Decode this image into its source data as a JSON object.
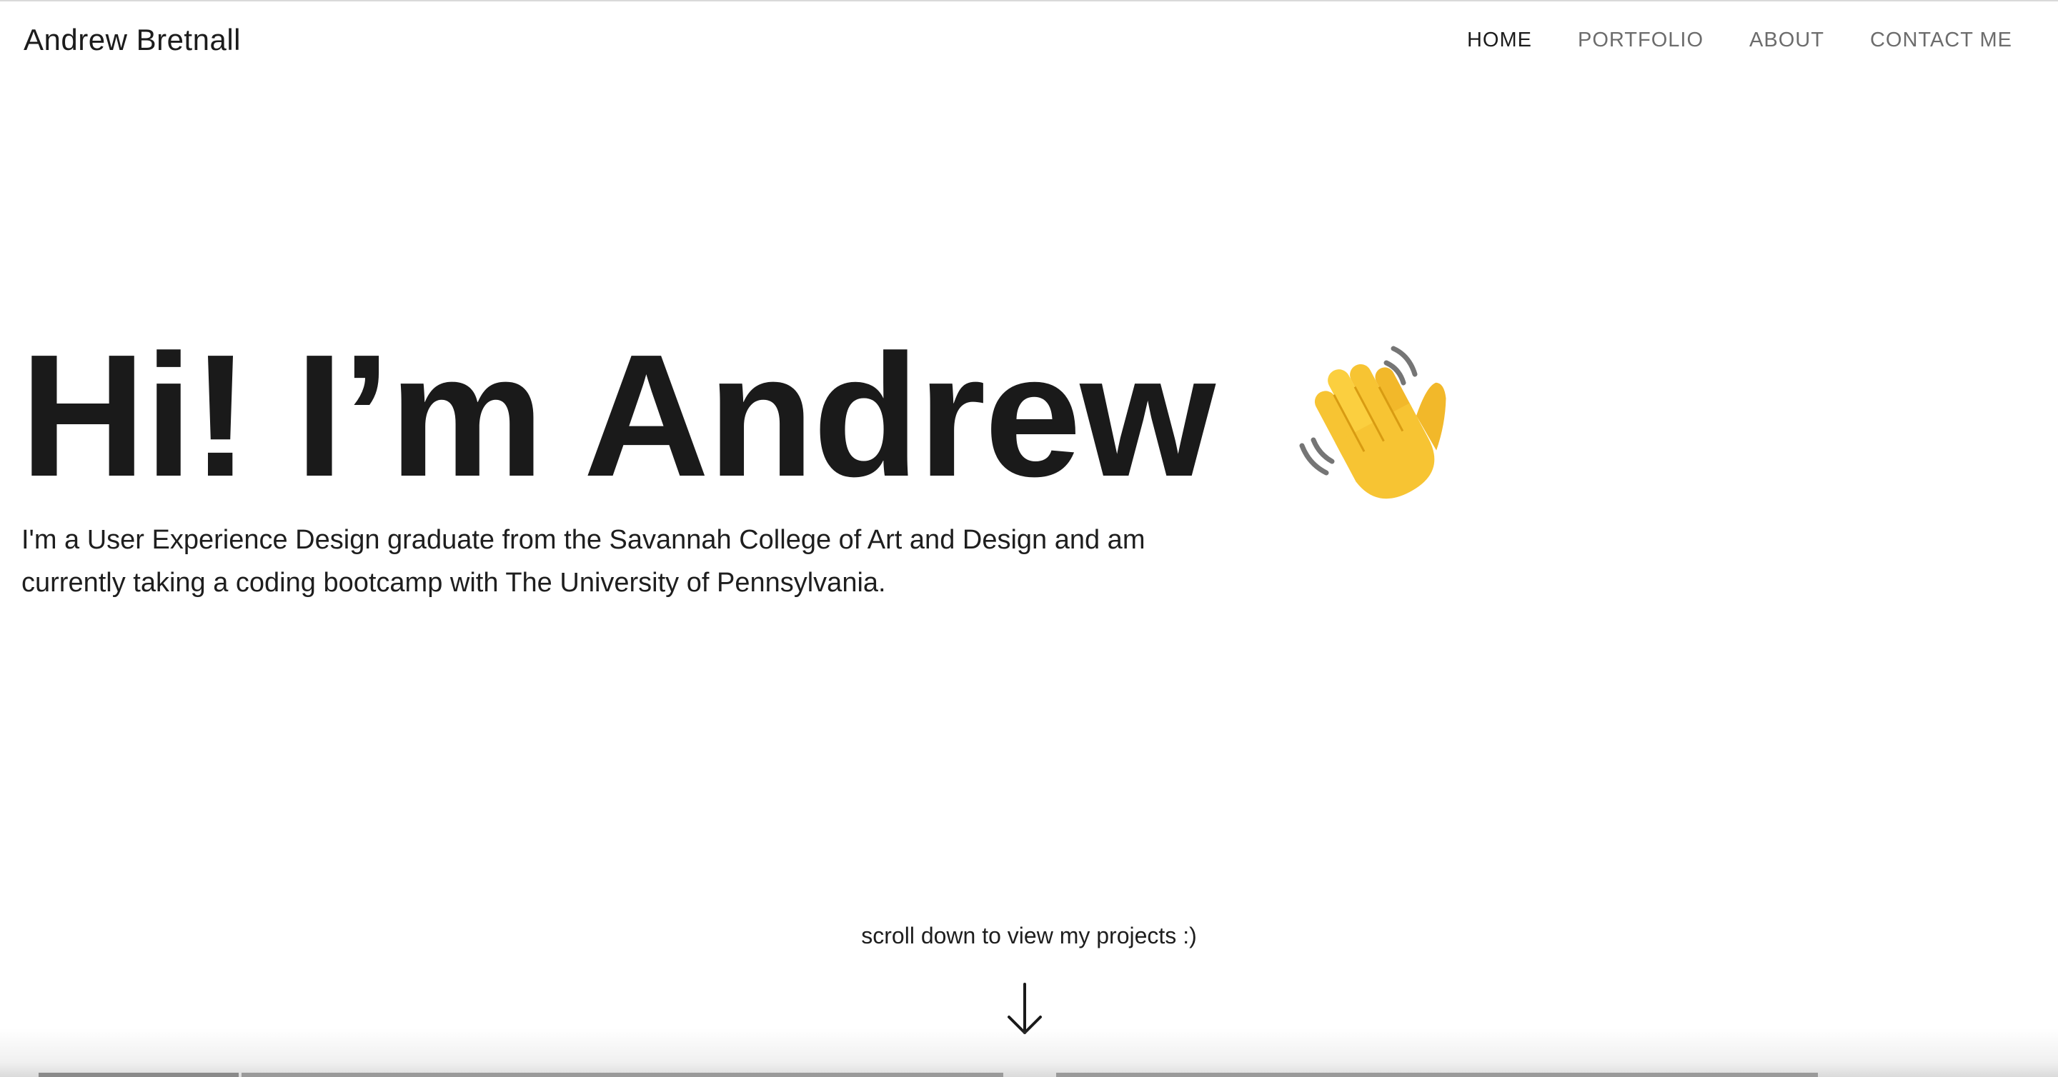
{
  "header": {
    "brand": "Andrew Bretnall",
    "nav": [
      {
        "label": "HOME",
        "active": true
      },
      {
        "label": "PORTFOLIO",
        "active": false
      },
      {
        "label": "ABOUT",
        "active": false
      },
      {
        "label": "CONTACT ME",
        "active": false
      }
    ]
  },
  "hero": {
    "title": "Hi! I’m Andrew",
    "emoji_icon": "waving-hand-icon",
    "description": "I'm a User Experience Design graduate from the Savannah College of Art and Design and am currently taking a coding bootcamp with The University of Pennsylvania."
  },
  "scroll": {
    "hint": "scroll down to view my projects :)",
    "icon": "arrow-down-icon"
  },
  "colors": {
    "text": "#161616",
    "nav_inactive": "#6c6c6c",
    "background": "#ffffff",
    "emoji_yellow": "#f7c433"
  }
}
